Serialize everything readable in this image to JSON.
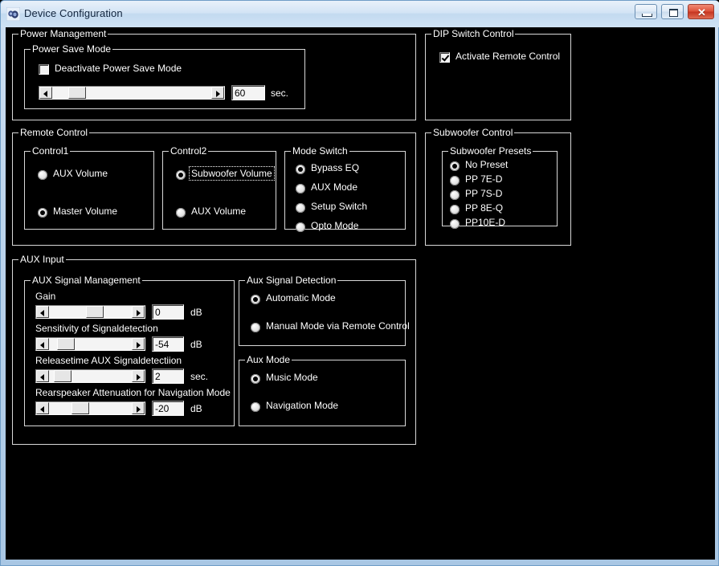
{
  "window": {
    "title": "Device Configuration",
    "icon": "speaker-icon",
    "controls": {
      "minimize": "–",
      "maximize": "□",
      "close": "✕"
    }
  },
  "power_management": {
    "title": "Power Management",
    "power_save_mode": {
      "title": "Power Save Mode",
      "checkbox_label": "Deactivate Power Save Mode",
      "checkbox_checked": false,
      "slider_value": "60",
      "unit": "sec."
    }
  },
  "dip_switch_control": {
    "title": "DIP Switch Control",
    "checkbox_label": "Activate Remote Control",
    "checkbox_checked": true
  },
  "remote_control": {
    "title": "Remote Control",
    "control1": {
      "title": "Control1",
      "options": [
        {
          "label": "AUX Volume",
          "selected": false
        },
        {
          "label": "Master Volume",
          "selected": true
        }
      ]
    },
    "control2": {
      "title": "Control2",
      "options": [
        {
          "label": "Subwoofer Volume",
          "selected": true,
          "focused": true
        },
        {
          "label": "AUX Volume",
          "selected": false
        }
      ]
    },
    "mode_switch": {
      "title": "Mode Switch",
      "options": [
        {
          "label": "Bypass EQ",
          "selected": true
        },
        {
          "label": "AUX Mode",
          "selected": false
        },
        {
          "label": "Setup Switch",
          "selected": false
        },
        {
          "label": "Opto Mode",
          "selected": false
        }
      ]
    }
  },
  "subwoofer_control": {
    "title": "Subwoofer Control",
    "presets": {
      "title": "Subwoofer Presets",
      "options": [
        {
          "label": "No Preset",
          "selected": true
        },
        {
          "label": "PP 7E-D",
          "selected": false
        },
        {
          "label": "PP 7S-D",
          "selected": false
        },
        {
          "label": "PP 8E-Q",
          "selected": false
        },
        {
          "label": "PP10E-D",
          "selected": false
        }
      ]
    }
  },
  "aux_input": {
    "title": "AUX Input",
    "signal_management": {
      "title": "AUX Signal Management",
      "sliders": [
        {
          "label": "Gain",
          "value": "0",
          "unit": "dB"
        },
        {
          "label": "Sensitivity of Signaldetection",
          "value": "-54",
          "unit": "dB"
        },
        {
          "label": "Releasetime AUX Signaldetectiion",
          "value": "2",
          "unit": "sec."
        },
        {
          "label": "Rearspeaker Attenuation for Navigation Mode",
          "value": "-20",
          "unit": "dB"
        }
      ]
    },
    "signal_detection": {
      "title": "Aux Signal Detection",
      "options": [
        {
          "label": "Automatic Mode",
          "selected": true
        },
        {
          "label": "Manual Mode via Remote Control",
          "selected": false
        }
      ]
    },
    "aux_mode": {
      "title": "Aux Mode",
      "options": [
        {
          "label": "Music Mode",
          "selected": true
        },
        {
          "label": "Navigation Mode",
          "selected": false
        }
      ]
    }
  },
  "colors": {
    "client_background": "#000000",
    "text": "#ffffff",
    "group_border": "#d8d8d8",
    "titlebar_text": "#10233c",
    "close_button": "#c53420"
  }
}
